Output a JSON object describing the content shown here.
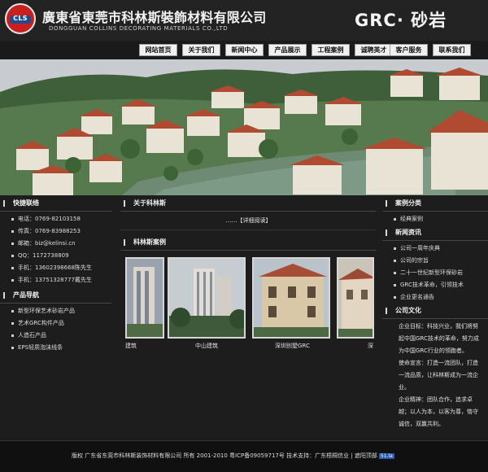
{
  "header": {
    "logo_text": "CLS",
    "company_cn": "廣東省東莞市科林斯裝飾材料有限公司",
    "company_en": "DONGGUAN COLLINS DECORATING MATERIALS CO.,LTD",
    "slogan": "GRC· 砂岩"
  },
  "nav": {
    "items": [
      "网站首页",
      "关于我们",
      "新闻中心",
      "产品展示",
      "工程案例",
      "诚聘英才",
      "客户服务",
      "联系我们"
    ]
  },
  "contact": {
    "title": "快捷联络",
    "items": [
      "电话：0769-82103158",
      "传真：0769-83988253",
      "邮箱：biz@kelinsi.cn",
      "QQ：1172738809",
      "手机：13602398668陈先生",
      "手机：13751328777戴先生"
    ]
  },
  "product_nav": {
    "title": "产品导航",
    "items": [
      "新型环保艺术砂岩产品",
      "艺术GRC构件产品",
      "人造石产品",
      "EPS轻质泡沫线条"
    ]
  },
  "about": {
    "title": "关于科林斯",
    "read_more": "……【详细阅读】"
  },
  "cases": {
    "title": "科林斯案例",
    "captions": [
      "建筑",
      "中山建筑",
      "深圳别墅GRC",
      "深"
    ]
  },
  "case_category": {
    "title": "案例分类",
    "items": [
      "经典案例"
    ]
  },
  "news": {
    "title": "新闻资讯",
    "items": [
      "公司一周年庆典",
      "公司的宗旨",
      "二十一世纪新型环保砂岩",
      "GRC技术革命，引领技术",
      "企业更名通告"
    ]
  },
  "culture": {
    "title": "公司文化",
    "lines": [
      "企业目标：科技兴业，我们将努",
      "起中国GRC技术的革命，努力成",
      "为中国GRC行业的领跑者。",
      "使命宣言：打造一流团队，打造",
      "一流品质，让科林斯成为一流企",
      "业。",
      "企业精神：团队合作，追求卓",
      "越；以人为本，以客为尊，恪守",
      "诚信，双赢共利。"
    ]
  },
  "footer": {
    "text": "版权  广东省东莞市科林斯装饰材料有限公司  所有  2001-2010 粤ICP备09059717号  技术支持：广东梧桐信业 | 遮阳顶部",
    "badge": "51.la"
  },
  "colors": {
    "background": "#1d1d1d",
    "brand_red": "#c8201f",
    "brand_blue": "#1f4b8f"
  }
}
